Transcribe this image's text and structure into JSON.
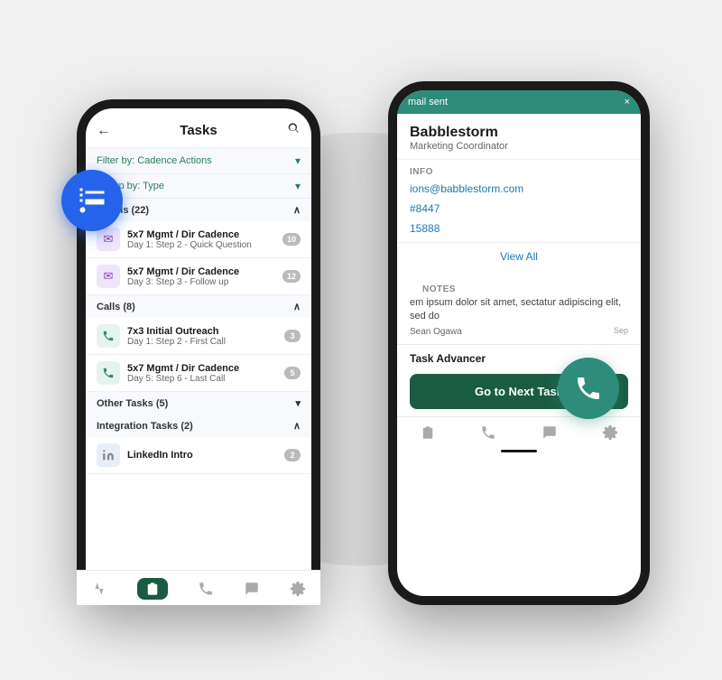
{
  "background": {
    "circle_color": "#e0e0e0"
  },
  "left_phone": {
    "header": {
      "back_icon": "←",
      "title": "Tasks",
      "search_icon": "🔍"
    },
    "filter_bar": {
      "label": "Filter by: Cadence Actions",
      "icon": "chevron-down"
    },
    "group_bar": {
      "label": "Group by: Type",
      "icon": "chevron-down"
    },
    "sections": [
      {
        "title": "Emails (22)",
        "collapsed": false,
        "icon": "chevron-up",
        "items": [
          {
            "icon_type": "email",
            "name": "5x7 Mgmt / Dir Cadence",
            "sub": "Day 1: Step 2 - Quick Question",
            "badge": "10"
          },
          {
            "icon_type": "email",
            "name": "5x7 Mgmt / Dir Cadence",
            "sub": "Day 3: Step 3 - Follow up",
            "badge": "12"
          }
        ]
      },
      {
        "title": "Calls (8)",
        "collapsed": false,
        "icon": "chevron-up",
        "items": [
          {
            "icon_type": "call",
            "name": "7x3 Initial Outreach",
            "sub": "Day 1: Step 2 - First Call",
            "badge": "3"
          },
          {
            "icon_type": "call",
            "name": "5x7 Mgmt / Dir Cadence",
            "sub": "Day 5: Step 6 - Last Call",
            "badge": "5"
          }
        ]
      },
      {
        "title": "Other Tasks (5)",
        "collapsed": true,
        "icon": "chevron-down",
        "items": []
      },
      {
        "title": "Integration Tasks (2)",
        "collapsed": false,
        "icon": "chevron-up",
        "items": [
          {
            "icon_type": "linkedin",
            "name": "LinkedIn Intro",
            "sub": "",
            "badge": "2"
          }
        ]
      }
    ],
    "bottom_nav": [
      {
        "icon": "activity",
        "label": "activity-icon",
        "active": false
      },
      {
        "icon": "tasks",
        "label": "tasks-icon",
        "active": true
      },
      {
        "icon": "phone",
        "label": "phone-icon",
        "active": false
      },
      {
        "icon": "message",
        "label": "message-icon",
        "active": false
      },
      {
        "icon": "settings",
        "label": "settings-icon",
        "active": false
      }
    ]
  },
  "right_phone": {
    "mail_sent_bar": {
      "text": "mail sent",
      "close_icon": "×"
    },
    "contact": {
      "name": "Babblestorm",
      "role": "Marketing Coordinator"
    },
    "info_section": {
      "label": "Info",
      "email": "ions@babblestorm.com",
      "phone1": "#8447",
      "phone2": "15888",
      "view_all": "View All"
    },
    "notes_section": {
      "label": "Notes",
      "text": "em ipsum dolor sit amet, sectatur adipiscing elit, sed do",
      "author": "Sean Ogawa",
      "date": "Sep"
    },
    "task_advancer": {
      "title": "Task Advancer",
      "button_label": "Go to Next Task"
    },
    "bottom_nav": [
      {
        "icon": "tasks",
        "label": "tasks-icon",
        "active": false
      },
      {
        "icon": "phone",
        "label": "phone-icon",
        "active": false
      },
      {
        "icon": "message",
        "label": "message-icon",
        "active": false
      },
      {
        "icon": "settings",
        "label": "settings-icon",
        "active": false
      }
    ]
  },
  "fabs": {
    "tasks_label": "tasks-fab",
    "phone_label": "phone-fab"
  }
}
